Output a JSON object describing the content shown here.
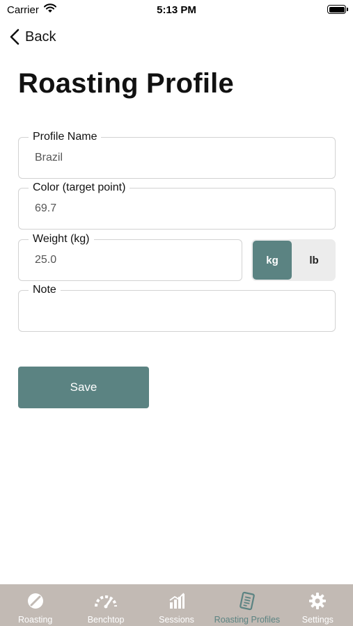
{
  "status_bar": {
    "carrier": "Carrier",
    "time": "5:13 PM"
  },
  "nav": {
    "back_label": "Back"
  },
  "page_title": "Roasting Profile",
  "form": {
    "profile_name": {
      "label": "Profile Name",
      "value": "Brazil"
    },
    "color": {
      "label": "Color (target point)",
      "value": "69.7"
    },
    "weight": {
      "label": "Weight  (kg)",
      "value": "25.0"
    },
    "note": {
      "label": "Note",
      "value": ""
    },
    "unit_toggle": {
      "options": [
        "kg",
        "lb"
      ],
      "selected": "kg"
    },
    "save_label": "Save"
  },
  "tab_bar": {
    "tabs": [
      {
        "label": "Roasting",
        "icon": "coffee-bean-icon"
      },
      {
        "label": "Benchtop",
        "icon": "gauge-icon"
      },
      {
        "label": "Sessions",
        "icon": "bar-chart-icon"
      },
      {
        "label": "Roasting Profiles",
        "icon": "document-list-icon",
        "active": true
      },
      {
        "label": "Settings",
        "icon": "gear-icon"
      }
    ]
  },
  "colors": {
    "accent": "#5b8382",
    "tab_bar_bg": "#c2bab4",
    "field_border": "#d2d2d2"
  }
}
